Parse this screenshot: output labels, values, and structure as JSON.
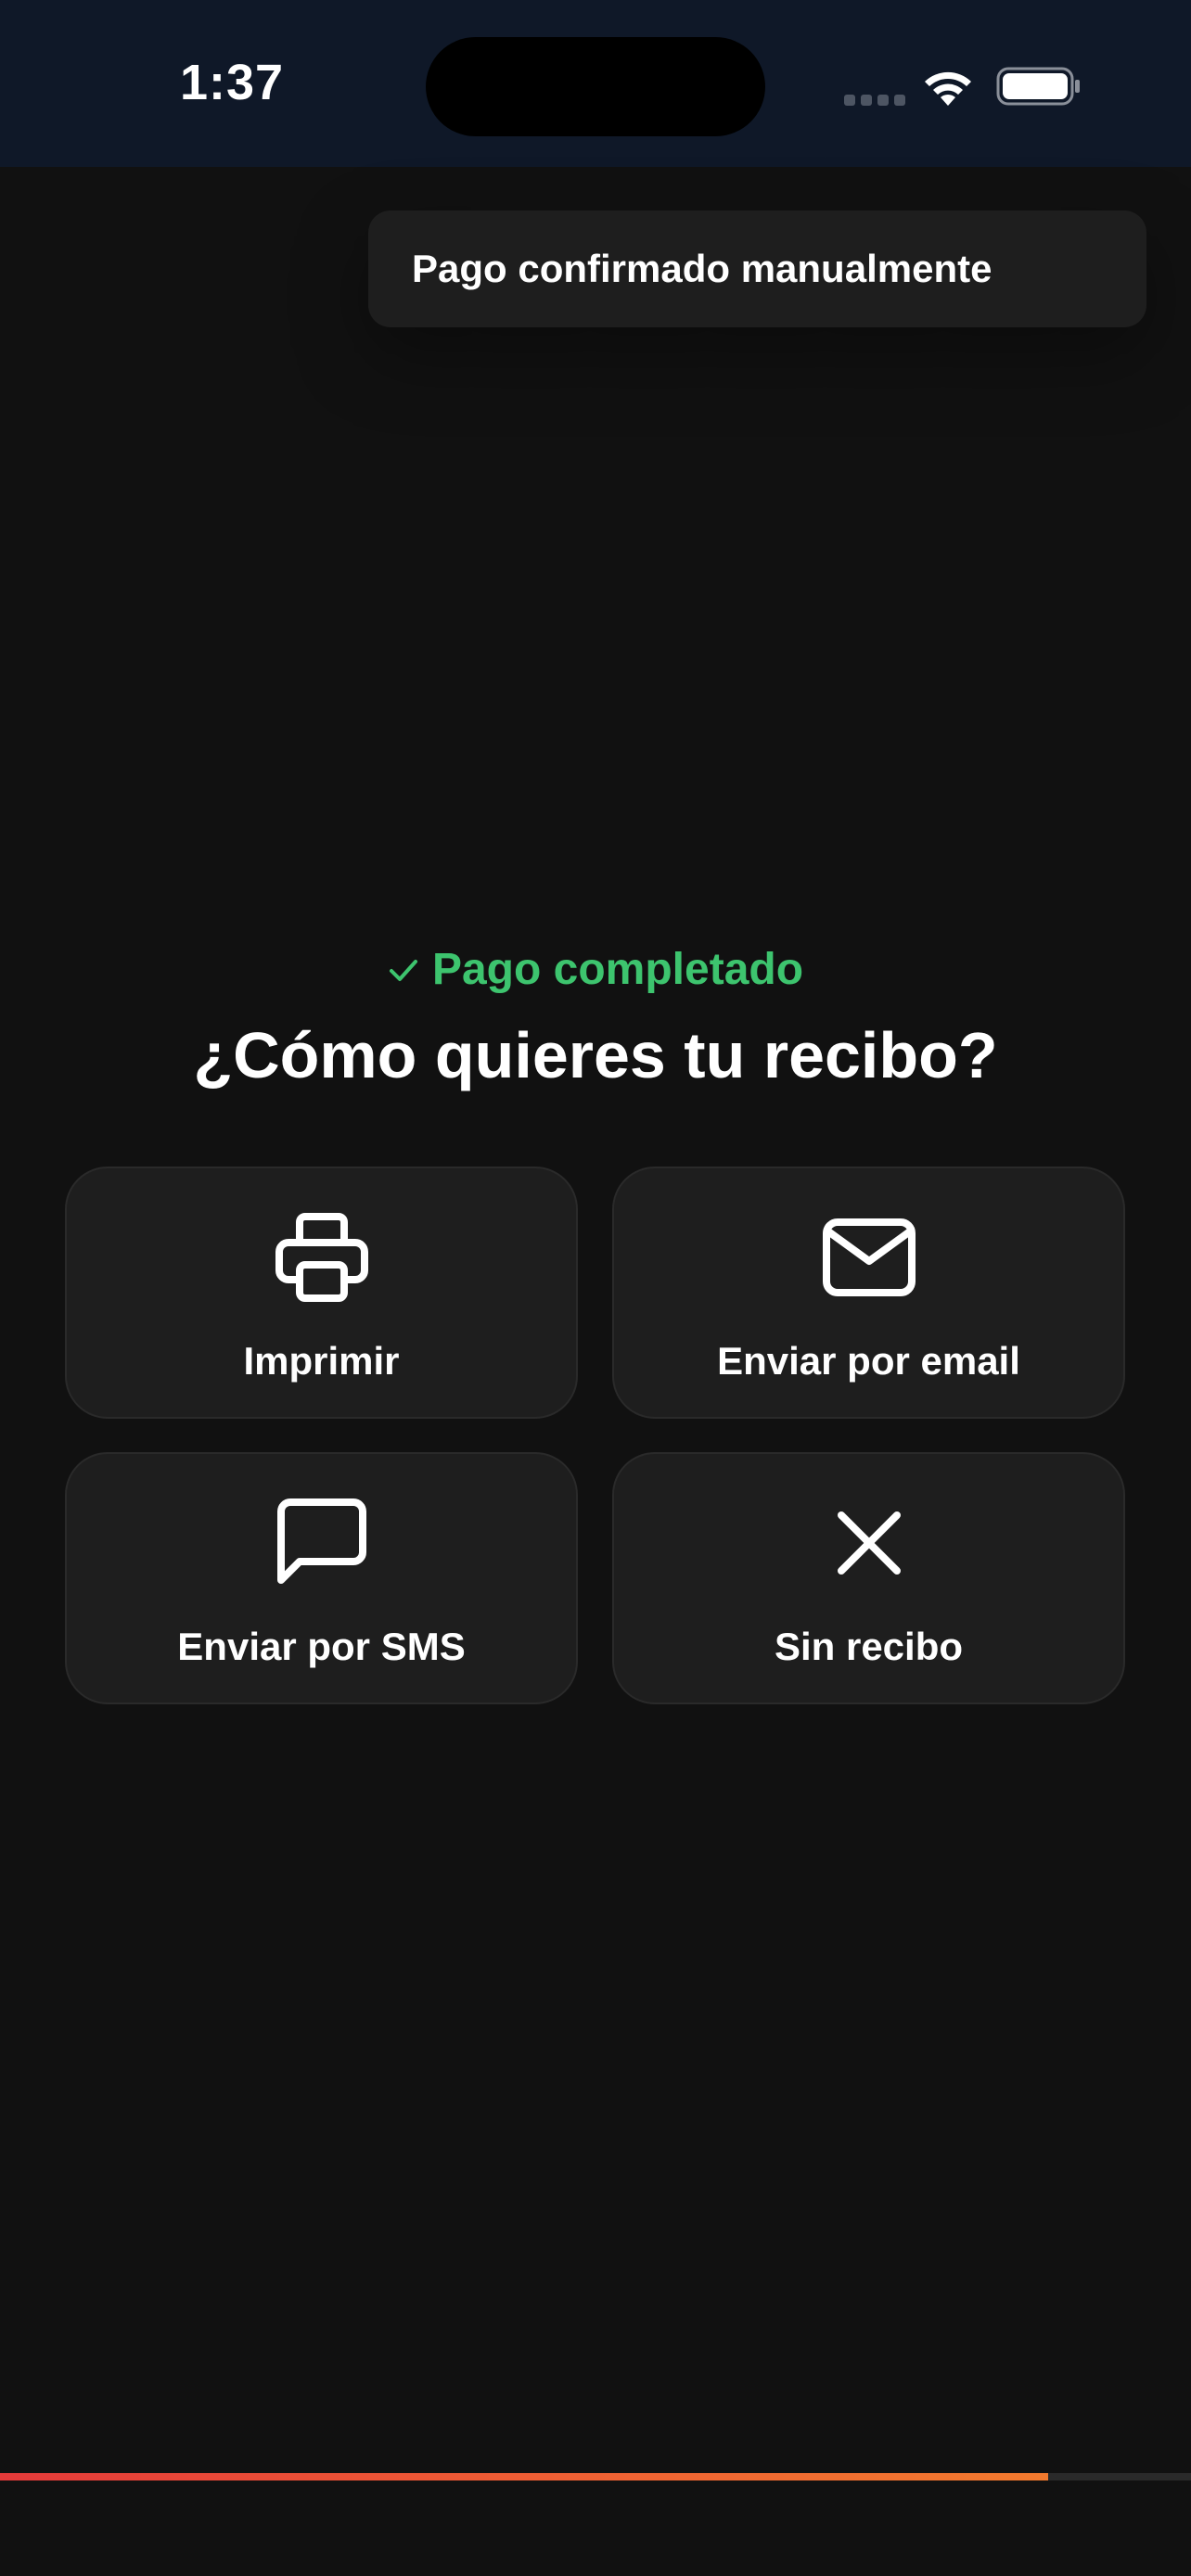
{
  "status_bar": {
    "time": "1:37",
    "icons": [
      "cellular-signal-icon",
      "wifi-icon",
      "battery-icon"
    ]
  },
  "toast": {
    "message": "Pago confirmado manualmente"
  },
  "payment": {
    "status_icon": "check-icon",
    "status_text": "Pago completado",
    "status_color": "#3dc46e"
  },
  "receipt": {
    "title": "¿Cómo quieres tu recibo?",
    "options": [
      {
        "icon": "printer-icon",
        "label": "Imprimir"
      },
      {
        "icon": "mail-icon",
        "label": "Enviar por email"
      },
      {
        "icon": "message-icon",
        "label": "Enviar por SMS"
      },
      {
        "icon": "close-icon",
        "label": "Sin recibo"
      }
    ]
  },
  "progress": {
    "value": 0.88,
    "colors": [
      "#e43a3a",
      "#f27a2e"
    ]
  },
  "colors": {
    "background": "#111111",
    "status_bar": "#0f1828",
    "card": "#1e1e1e",
    "accent_success": "#3dc46e"
  }
}
